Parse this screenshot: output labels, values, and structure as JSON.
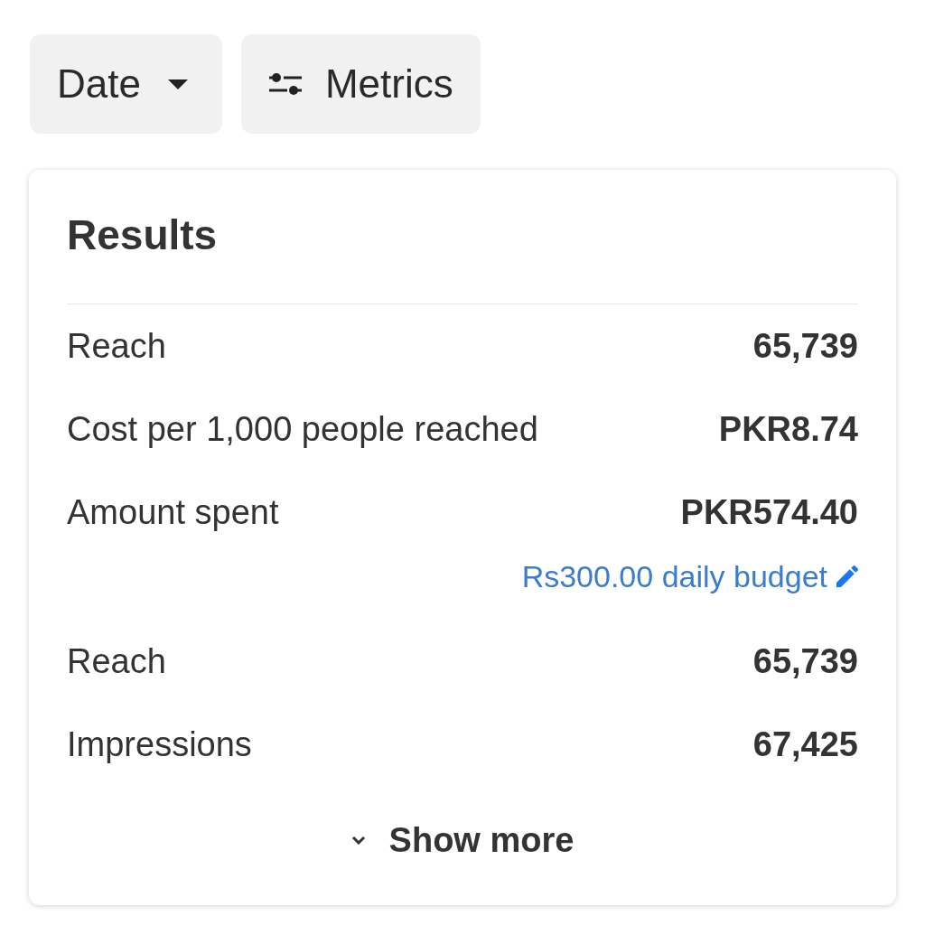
{
  "toolbar": {
    "buttons": [
      {
        "label": "Date",
        "kind": "dropdown"
      },
      {
        "label": "Metrics",
        "kind": "filter"
      }
    ]
  },
  "results_card": {
    "title": "Results",
    "rows": [
      {
        "label": "Reach",
        "value": "65,739"
      },
      {
        "label": "Cost per 1,000 people reached",
        "value": "PKR8.74"
      },
      {
        "label": "Amount spent",
        "value": "PKR574.40",
        "budget_link": "Rs300.00 daily budget"
      },
      {
        "label": "Reach",
        "value": "65,739"
      },
      {
        "label": "Impressions",
        "value": "67,425"
      }
    ],
    "show_more": {
      "label": "Show more"
    }
  }
}
